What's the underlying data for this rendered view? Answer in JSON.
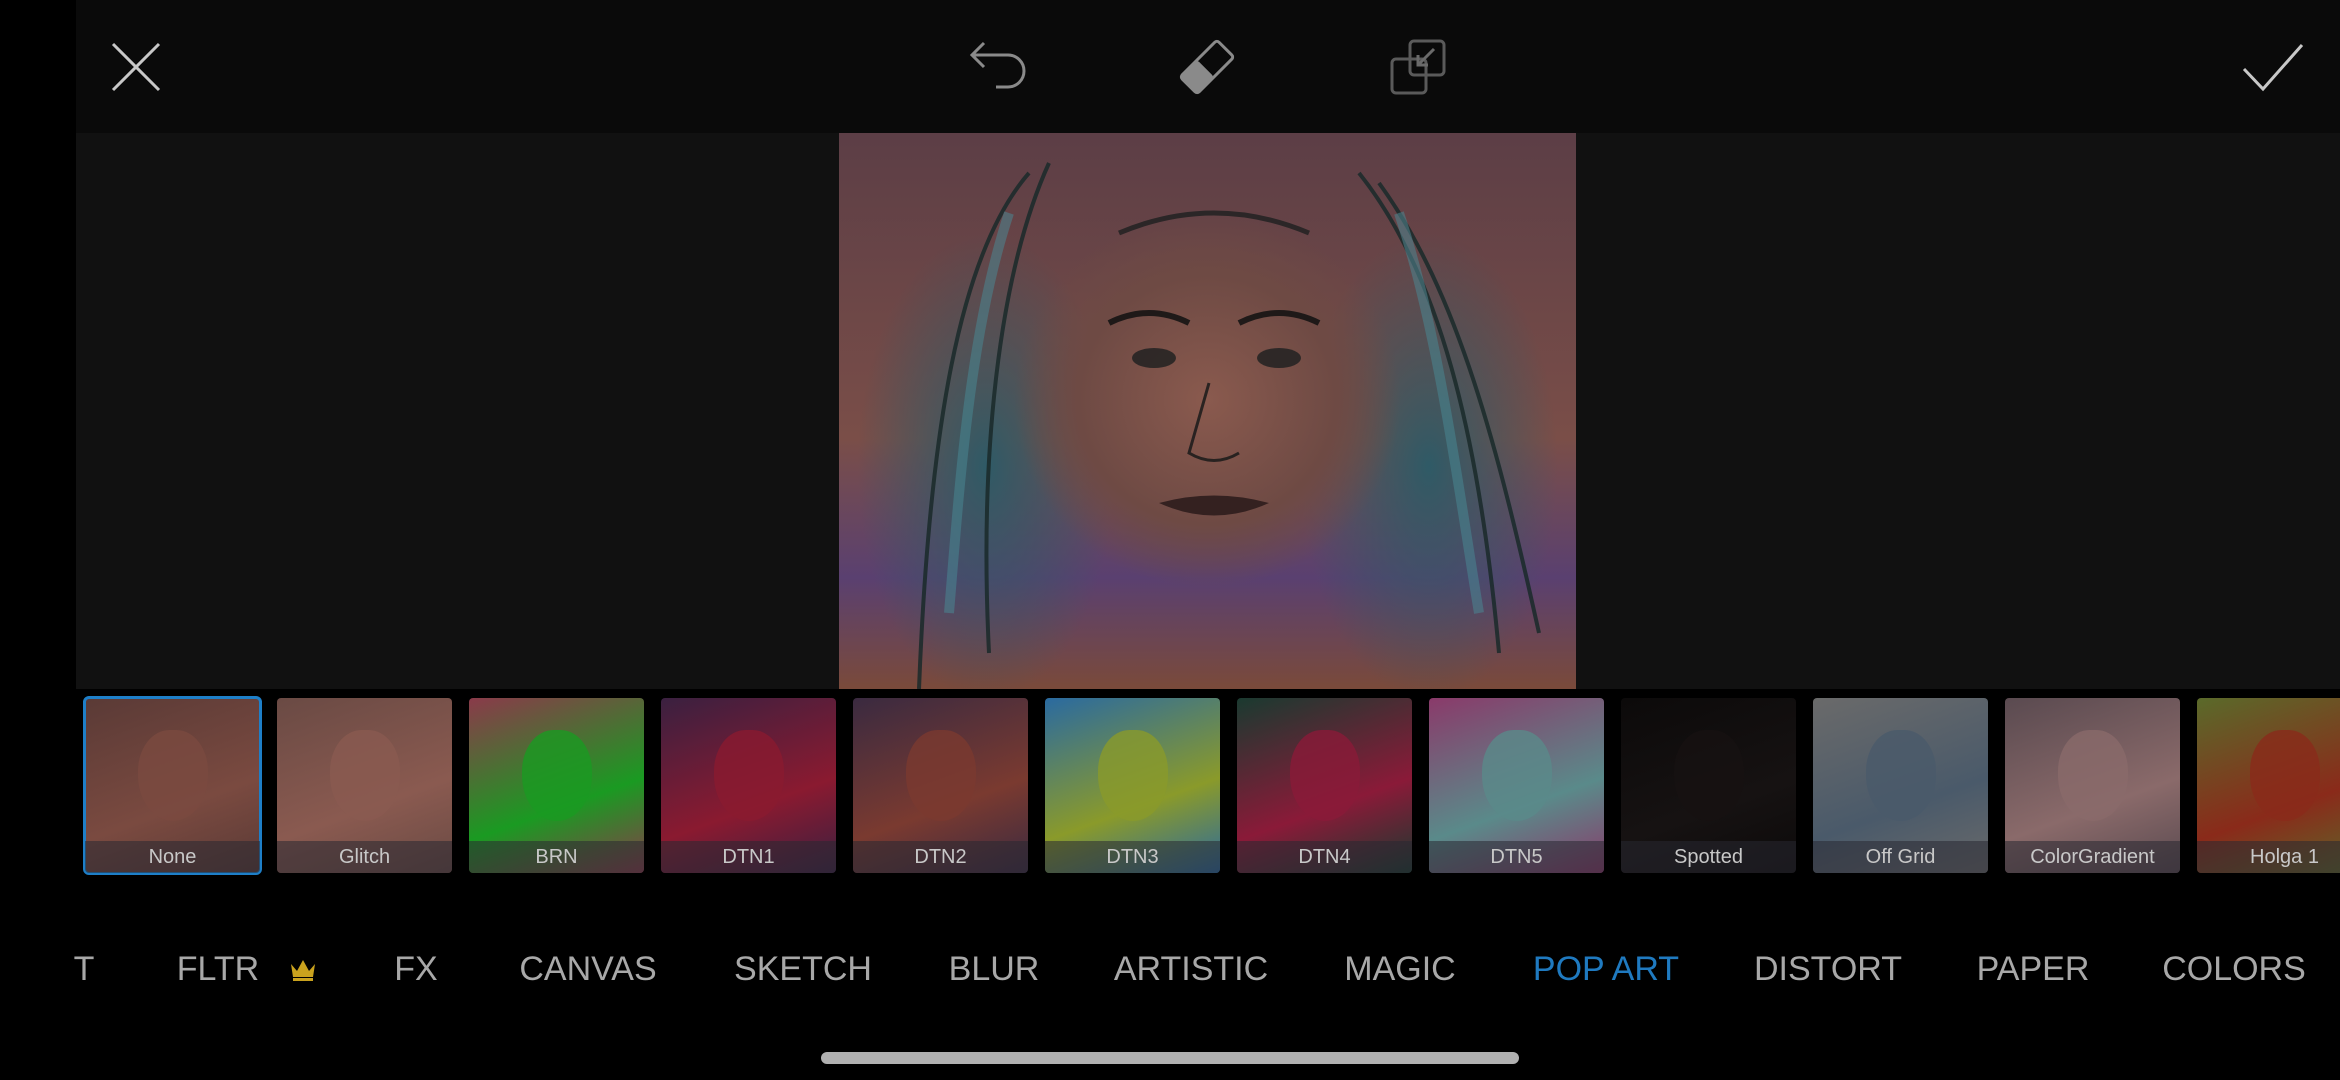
{
  "toolbar": {
    "close_icon": "close-icon",
    "undo_icon": "undo-icon",
    "eraser_icon": "eraser-icon",
    "compare_icon": "compare-icon",
    "apply_icon": "checkmark-icon"
  },
  "effects": [
    {
      "label": "None",
      "selected": true,
      "tint": "#5a3a36",
      "face": "#7a4a40"
    },
    {
      "label": "Glitch",
      "selected": false,
      "tint": "#6a4a44",
      "face": "#8a5a50"
    },
    {
      "label": "BRN",
      "selected": false,
      "tint": "#8a3a4a",
      "face": "#1a9a22"
    },
    {
      "label": "DTN1",
      "selected": false,
      "tint": "#3a2040",
      "face": "#8a1a30"
    },
    {
      "label": "DTN2",
      "selected": false,
      "tint": "#3a2a40",
      "face": "#7a3a30"
    },
    {
      "label": "DTN3",
      "selected": false,
      "tint": "#2a6aa0",
      "face": "#8a9a2a"
    },
    {
      "label": "DTN4",
      "selected": false,
      "tint": "#1a3a30",
      "face": "#8a1a38"
    },
    {
      "label": "DTN5",
      "selected": false,
      "tint": "#8a3a6a",
      "face": "#5a8a8a"
    },
    {
      "label": "Spotted",
      "selected": false,
      "tint": "#0c0a0a",
      "face": "#161212"
    },
    {
      "label": "Off Grid",
      "selected": false,
      "tint": "#6a6a6a",
      "face": "#4a5a6a"
    },
    {
      "label": "ColorGradient",
      "selected": false,
      "tint": "#5a4a50",
      "face": "#8a6a6a"
    },
    {
      "label": "Holga 1",
      "selected": false,
      "tint": "#5a6a2a",
      "face": "#8a2a1a"
    }
  ],
  "categories": [
    {
      "label": "T",
      "active": false
    },
    {
      "label": "FLTR",
      "active": false,
      "badge": "crown-icon"
    },
    {
      "label": "FX",
      "active": false
    },
    {
      "label": "CANVAS",
      "active": false
    },
    {
      "label": "SKETCH",
      "active": false
    },
    {
      "label": "BLUR",
      "active": false
    },
    {
      "label": "ARTISTIC",
      "active": false
    },
    {
      "label": "MAGIC",
      "active": false
    },
    {
      "label": "POP ART",
      "active": true
    },
    {
      "label": "DISTORT",
      "active": false
    },
    {
      "label": "PAPER",
      "active": false
    },
    {
      "label": "COLORS",
      "active": false
    }
  ],
  "colors": {
    "accent": "#1f7ac0",
    "crown": "#c9a21e"
  }
}
